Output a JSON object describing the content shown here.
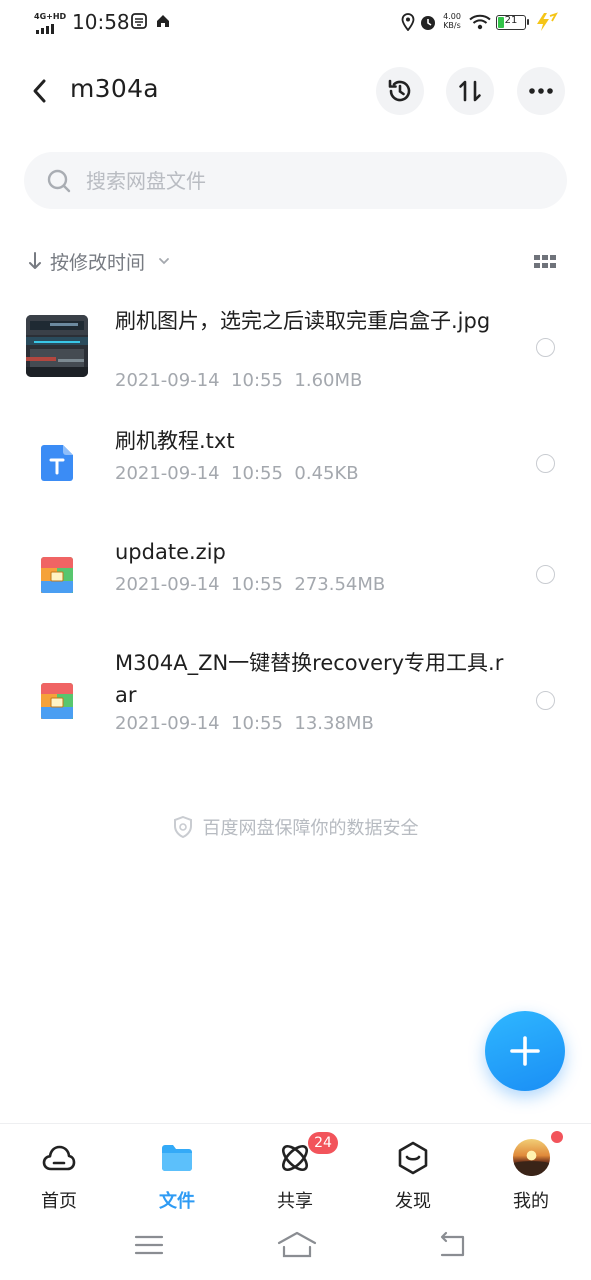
{
  "status_bar": {
    "network": "4G+HD",
    "time": "10:58",
    "speed_value": "4.00",
    "speed_unit": "KB/s",
    "battery": "21"
  },
  "header": {
    "title": "m304a"
  },
  "search": {
    "placeholder": "搜索网盘文件"
  },
  "sort": {
    "label": "按修改时间"
  },
  "files": [
    {
      "name": "刷机图片，选完之后读取完重启盒子.jpg",
      "date": "2021-09-14  10:55",
      "size": "1.60MB",
      "icon": "image-thumbnail"
    },
    {
      "name": "刷机教程.txt",
      "date": "2021-09-14  10:55",
      "size": "0.45KB",
      "icon": "text-file-icon"
    },
    {
      "name": "update.zip",
      "date": "2021-09-14  10:55",
      "size": "273.54MB",
      "icon": "archive-icon"
    },
    {
      "name": "M304A_ZN一键替换recovery专用工具.rar",
      "date": "2021-09-14  10:55",
      "size": "13.38MB",
      "icon": "archive-icon"
    }
  ],
  "footer_note": "百度网盘保障你的数据安全",
  "bottom_nav": {
    "items": [
      {
        "label": "首页",
        "icon": "cloud-home-icon"
      },
      {
        "label": "文件",
        "icon": "folder-icon"
      },
      {
        "label": "共享",
        "icon": "share-orbit-icon"
      },
      {
        "label": "发现",
        "icon": "discover-box-icon"
      },
      {
        "label": "我的",
        "icon": "avatar"
      }
    ],
    "share_badge": "24"
  },
  "colors": {
    "accent": "#2e9bf4",
    "badge": "#f2545b",
    "meta_text": "#a4a8ae"
  }
}
